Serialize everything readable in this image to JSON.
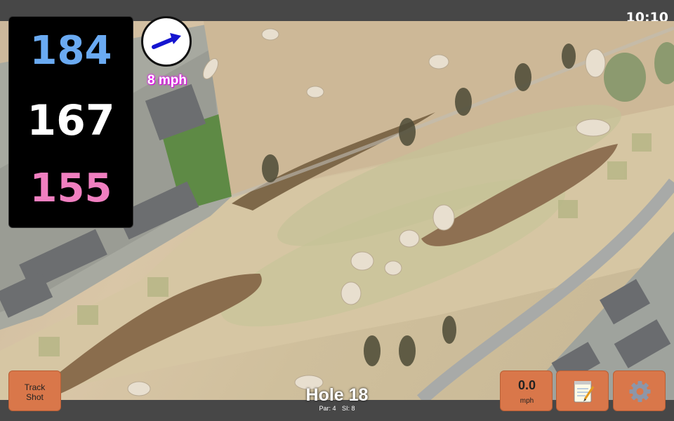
{
  "status_bar": {
    "time": "10:10"
  },
  "distances": {
    "back": "184",
    "middle": "167",
    "front": "155"
  },
  "wind": {
    "speed_label": "8 mph",
    "direction_icon": "arrow-right-up-icon"
  },
  "hole": {
    "title": "Hole 18",
    "par_label": "Par: 4",
    "si_label": "SI: 8"
  },
  "buttons": {
    "track_shot": {
      "line1": "Track",
      "line2": "Shot"
    },
    "speed": {
      "value": "0.0",
      "unit": "mph"
    },
    "notes": {
      "icon": "notepad-icon"
    },
    "settings": {
      "icon": "gear-icon"
    }
  },
  "colors": {
    "back": "#6aaaf2",
    "middle": "#ffffff",
    "front": "#f07fc0",
    "button": "#d9774a"
  }
}
